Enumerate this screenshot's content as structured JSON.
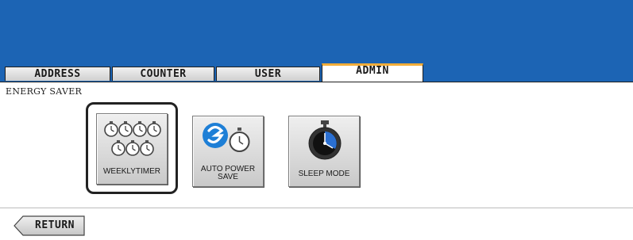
{
  "tabs": [
    {
      "label": "ADDRESS",
      "active": false
    },
    {
      "label": "COUNTER",
      "active": false
    },
    {
      "label": "USER",
      "active": false
    },
    {
      "label": "ADMIN",
      "active": true
    }
  ],
  "section": {
    "title": "ENERGY SAVER"
  },
  "buttons": {
    "weekly_timer": {
      "label": "WEEKLYTIMER",
      "selected": true,
      "icon": "stopwatch-grid-icon"
    },
    "auto_power_save": {
      "label_line1": "AUTO POWER",
      "label_line2": "SAVE",
      "icon": "auto-power-save-icon"
    },
    "sleep_mode": {
      "label": "SLEEP MODE",
      "icon": "sleep-mode-clock-icon"
    }
  },
  "footer": {
    "return_label": "RETURN"
  },
  "colors": {
    "header_blue": "#1c64b4",
    "active_tab_accent": "#f2ad3a",
    "icon_blue": "#1e7fd6"
  }
}
